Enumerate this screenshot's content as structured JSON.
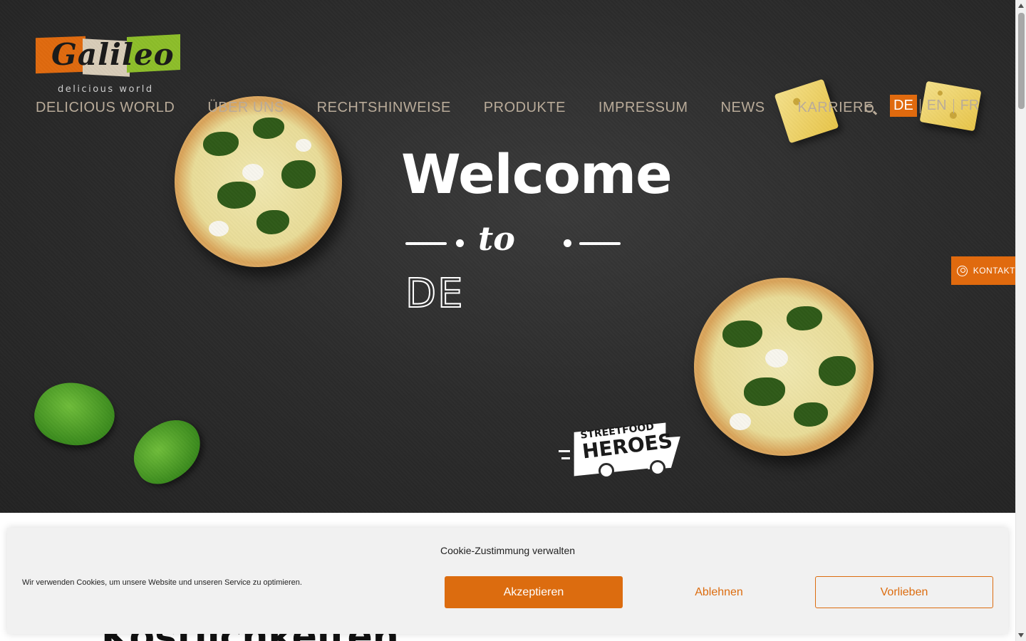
{
  "brand": {
    "logo_text": "Galileo",
    "tagline": "delicious world",
    "colors": {
      "accent": "#e06a0e",
      "green": "#8dbe2a",
      "beige": "#d8ccb8",
      "nav_text": "#b9ab99"
    }
  },
  "nav": {
    "items": [
      {
        "label": "DELICIOUS WORLD"
      },
      {
        "label": "ÜBER UNS"
      },
      {
        "label": "RECHTSHINWEISE"
      },
      {
        "label": "PRODUKTE"
      },
      {
        "label": "IMPRESSUM"
      },
      {
        "label": "NEWS"
      },
      {
        "label": "KARRIERE"
      }
    ],
    "search_icon": "search-icon",
    "languages": [
      {
        "label": "DE",
        "active": true
      },
      {
        "label": "EN",
        "active": false
      },
      {
        "label": "FR",
        "active": false
      }
    ]
  },
  "hero": {
    "welcome": "Welcome",
    "to": "to",
    "animated_word_partial": "DE",
    "badge_line1": "STREETFOOD",
    "badge_line2": "HEROES"
  },
  "kontakt": {
    "label": "KONTAKT",
    "icon": "user-circle-icon"
  },
  "below_hero": {
    "headline_peek": "Köstlichkeiten."
  },
  "cookie": {
    "title": "Cookie-Zustimmung verwalten",
    "text": "Wir verwenden Cookies, um unsere Website und unseren Service zu optimieren.",
    "accept_label": "Akzeptieren",
    "deny_label": "Ablehnen",
    "prefs_label": "Vorlieben",
    "accent_color": "#dc6c0f"
  }
}
